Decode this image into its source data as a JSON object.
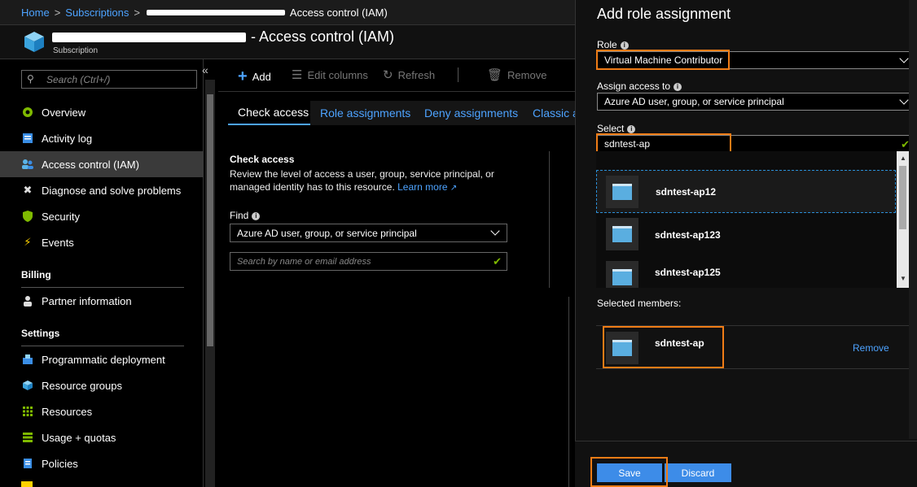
{
  "breadcrumb": {
    "home": "Home",
    "subscriptions": "Subscriptions",
    "current": "Access control (IAM)"
  },
  "titlebar": {
    "title": "- Access control (IAM)",
    "subtitle": "Subscription"
  },
  "sidebar": {
    "search_placeholder": "Search (Ctrl+/)",
    "collapse": "«",
    "items": [
      {
        "label": "Overview",
        "icon": "overview-icon"
      },
      {
        "label": "Activity log",
        "icon": "activity-log-icon"
      },
      {
        "label": "Access control (IAM)",
        "icon": "iam-icon"
      },
      {
        "label": "Diagnose and solve problems",
        "icon": "wrench-icon"
      },
      {
        "label": "Security",
        "icon": "shield-icon"
      },
      {
        "label": "Events",
        "icon": "lightning-icon"
      }
    ],
    "billing_heading": "Billing",
    "billing_items": [
      {
        "label": "Partner information",
        "icon": "person-icon"
      }
    ],
    "settings_heading": "Settings",
    "settings_items": [
      {
        "label": "Programmatic deployment",
        "icon": "deploy-icon"
      },
      {
        "label": "Resource groups",
        "icon": "cube-icon"
      },
      {
        "label": "Resources",
        "icon": "grid-icon"
      },
      {
        "label": "Usage + quotas",
        "icon": "bars-icon"
      },
      {
        "label": "Policies",
        "icon": "policy-icon"
      }
    ]
  },
  "toolbar": {
    "add": "Add",
    "edit_columns": "Edit columns",
    "refresh": "Refresh",
    "remove": "Remove"
  },
  "tabs": [
    "Check access",
    "Role assignments",
    "Deny assignments",
    "Classic a"
  ],
  "check_access": {
    "heading": "Check access",
    "description": "Review the level of access a user, group, service principal, or managed identity has to this resource.",
    "learn_more": "Learn more",
    "find_label": "Find",
    "find_value": "Azure AD user, group, or service principal",
    "search_placeholder": "Search by name or email address"
  },
  "blade": {
    "title": "Add role assignment",
    "role_label": "Role",
    "role_value": "Virtual Machine Contributor",
    "assign_label": "Assign access to",
    "assign_value": "Azure AD user, group, or service principal",
    "select_label": "Select",
    "select_value": "sdntest-ap",
    "results": [
      "sdntest-ap12",
      "sdntest-ap123",
      "sdntest-ap125"
    ],
    "selected_members_label": "Selected members:",
    "selected_member": "sdntest-ap",
    "remove": "Remove",
    "save": "Save",
    "discard": "Discard"
  },
  "colors": {
    "accent": "#4da3ff",
    "highlight": "#f07c16",
    "button": "#3d8ce8",
    "check": "#7fba00"
  }
}
